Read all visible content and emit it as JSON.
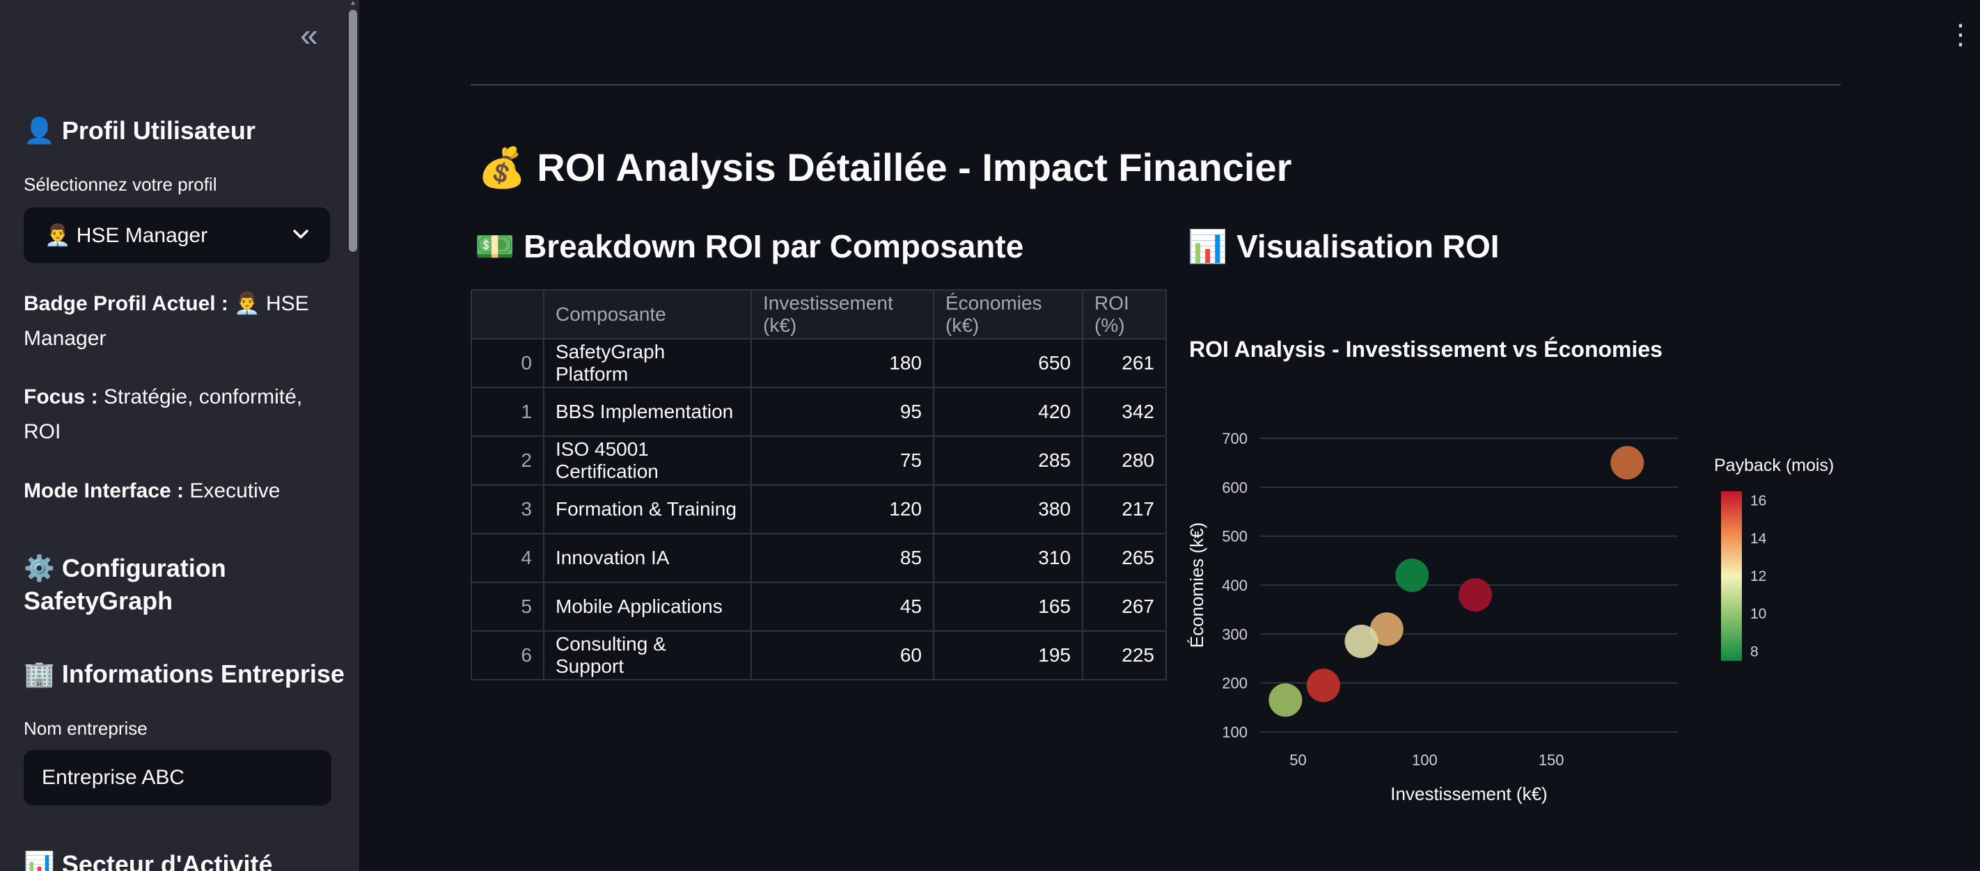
{
  "sidebar": {
    "collapse_icon": "«",
    "profile_heading": {
      "emoji": "👤",
      "text": "Profil Utilisateur"
    },
    "select_label": "Sélectionnez votre profil",
    "select_value": "👨‍💼 HSE Manager",
    "badge": {
      "label": "Badge Profil Actuel :",
      "value": "👨‍💼 HSE Manager"
    },
    "focus": {
      "label": "Focus :",
      "value": "Stratégie, conformité, ROI"
    },
    "mode": {
      "label": "Mode Interface :",
      "value": "Executive"
    },
    "config_heading": {
      "emoji": "⚙️",
      "text": "Configuration SafetyGraph"
    },
    "company_heading": {
      "emoji": "🏢",
      "text": "Informations Entreprise"
    },
    "company_label": "Nom entreprise",
    "company_value": "Entreprise ABC",
    "sector_heading": {
      "emoji": "📊",
      "text": "Secteur d'Activité"
    }
  },
  "main": {
    "menu_icon": "⋮",
    "title": {
      "emoji": "💰",
      "text": "ROI Analysis Détaillée - Impact Financier"
    },
    "breakdown_heading": {
      "emoji": "💵",
      "text": "Breakdown ROI par Composante"
    },
    "viz_heading": {
      "emoji": "📊",
      "text": "Visualisation ROI"
    },
    "table": {
      "headers": [
        "",
        "Composante",
        "Investissement (k€)",
        "Économies (k€)",
        "ROI (%)"
      ],
      "rows": [
        [
          "0",
          "SafetyGraph Platform",
          "180",
          "650",
          "261"
        ],
        [
          "1",
          "BBS Implementation",
          "95",
          "420",
          "342"
        ],
        [
          "2",
          "ISO 45001 Certification",
          "75",
          "285",
          "280"
        ],
        [
          "3",
          "Formation & Training",
          "120",
          "380",
          "217"
        ],
        [
          "4",
          "Innovation IA",
          "85",
          "310",
          "265"
        ],
        [
          "5",
          "Mobile Applications",
          "45",
          "165",
          "267"
        ],
        [
          "6",
          "Consulting & Support",
          "60",
          "195",
          "225"
        ]
      ]
    }
  },
  "chart_data": {
    "type": "scatter",
    "title": "ROI Analysis - Investissement vs Économies",
    "xlabel": "Investissement (k€)",
    "ylabel": "Économies (k€)",
    "x_ticks": [
      "50",
      "100",
      "150"
    ],
    "y_ticks": [
      "100",
      "200",
      "300",
      "400",
      "500",
      "600",
      "700"
    ],
    "xlim": [
      35,
      200
    ],
    "ylim": [
      100,
      700
    ],
    "grid": true,
    "colorbar": {
      "title": "Payback (mois)",
      "ticks": [
        "8",
        "10",
        "12",
        "14",
        "16"
      ],
      "range": [
        7.5,
        16.5
      ]
    },
    "points": [
      {
        "x": 180,
        "y": 650,
        "payback": 14.2,
        "color": "#c66a3b"
      },
      {
        "x": 95,
        "y": 420,
        "payback": 8.0,
        "color": "#0f8440"
      },
      {
        "x": 120,
        "y": 380,
        "payback": 16.0,
        "color": "#a1122d"
      },
      {
        "x": 85,
        "y": 310,
        "payback": 13.3,
        "color": "#d9a66a"
      },
      {
        "x": 75,
        "y": 285,
        "payback": 11.8,
        "color": "#d8d7a6"
      },
      {
        "x": 60,
        "y": 195,
        "payback": 15.0,
        "color": "#c3322c"
      },
      {
        "x": 45,
        "y": 165,
        "payback": 10.4,
        "color": "#9cbc64"
      }
    ]
  }
}
